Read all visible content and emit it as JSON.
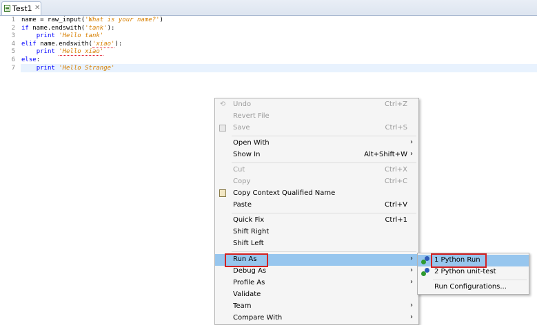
{
  "tab": {
    "title": "Test1",
    "close_glyph": "✕"
  },
  "editor": {
    "lines": [
      {
        "num": "1",
        "indent": "",
        "segments": [
          {
            "t": "name = raw_input(",
            "c": "plain"
          },
          {
            "t": "'What is your name?'",
            "c": "str"
          },
          {
            "t": ")",
            "c": "plain"
          }
        ]
      },
      {
        "num": "2",
        "indent": "",
        "segments": [
          {
            "t": "if",
            "c": "kw"
          },
          {
            "t": " name.endswith(",
            "c": "plain"
          },
          {
            "t": "'tank'",
            "c": "str"
          },
          {
            "t": "):",
            "c": "plain"
          }
        ]
      },
      {
        "num": "3",
        "indent": "    ",
        "segments": [
          {
            "t": "print",
            "c": "kw"
          },
          {
            "t": " ",
            "c": "plain"
          },
          {
            "t": "'Hello tank'",
            "c": "str"
          }
        ]
      },
      {
        "num": "4",
        "indent": "",
        "segments": [
          {
            "t": "elif",
            "c": "kw"
          },
          {
            "t": " name.endswith(",
            "c": "plain"
          },
          {
            "t": "'xiao'",
            "c": "str squig"
          },
          {
            "t": "):",
            "c": "plain"
          }
        ]
      },
      {
        "num": "5",
        "indent": "    ",
        "segments": [
          {
            "t": "print",
            "c": "kw"
          },
          {
            "t": " ",
            "c": "plain"
          },
          {
            "t": "'Hello xiao'",
            "c": "str squig"
          }
        ]
      },
      {
        "num": "6",
        "indent": "",
        "segments": [
          {
            "t": "else",
            "c": "kw"
          },
          {
            "t": ":",
            "c": "plain"
          }
        ]
      },
      {
        "num": "7",
        "indent": "    ",
        "segments": [
          {
            "t": "print",
            "c": "kw"
          },
          {
            "t": " ",
            "c": "plain"
          },
          {
            "t": "'Hello Strange'",
            "c": "str"
          }
        ]
      }
    ]
  },
  "context_menu": {
    "undo": {
      "label": "Undo",
      "shortcut": "Ctrl+Z",
      "icon": "undo-icon"
    },
    "revert": {
      "label": "Revert File"
    },
    "save": {
      "label": "Save",
      "shortcut": "Ctrl+S",
      "icon": "save-icon"
    },
    "open_with": {
      "label": "Open With",
      "arrow": "›"
    },
    "show_in": {
      "label": "Show In",
      "shortcut": "Alt+Shift+W",
      "arrow": "›"
    },
    "cut": {
      "label": "Cut",
      "shortcut": "Ctrl+X"
    },
    "copy": {
      "label": "Copy",
      "shortcut": "Ctrl+C"
    },
    "copy_ctx": {
      "label": "Copy Context Qualified Name",
      "icon": "copy-qualified-name-icon"
    },
    "paste": {
      "label": "Paste",
      "shortcut": "Ctrl+V"
    },
    "quick_fix": {
      "label": "Quick Fix",
      "shortcut": "Ctrl+1"
    },
    "shift_right": {
      "label": "Shift Right"
    },
    "shift_left": {
      "label": "Shift Left"
    },
    "run_as": {
      "label": "Run As",
      "arrow": "›"
    },
    "debug_as": {
      "label": "Debug As",
      "arrow": "›"
    },
    "profile_as": {
      "label": "Profile As",
      "arrow": "›"
    },
    "validate": {
      "label": "Validate"
    },
    "team": {
      "label": "Team",
      "arrow": "›"
    },
    "compare_with": {
      "label": "Compare With",
      "arrow": "›"
    }
  },
  "run_as_submenu": {
    "python_run": {
      "label": "1 Python Run",
      "icon": "python-run-icon"
    },
    "python_unittest": {
      "label": "2 Python unit-test",
      "icon": "python-unittest-icon"
    },
    "run_configs": {
      "label": "Run Configurations..."
    }
  },
  "colors": {
    "highlight": "#97c6ee",
    "annotation_box": "#d42121",
    "keyword": "#0000ff",
    "string": "#d77f00",
    "current_line": "#e8f2fe"
  }
}
